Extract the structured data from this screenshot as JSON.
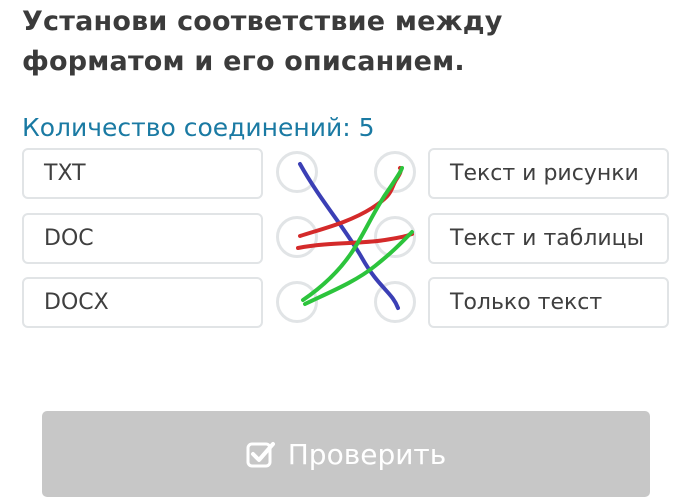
{
  "task": {
    "title": "Установи соответствие между форматом и его описанием.",
    "connections_label": "Количество соединений: 5"
  },
  "left_items": [
    {
      "label": "TXT"
    },
    {
      "label": "DOC"
    },
    {
      "label": "DOCX"
    }
  ],
  "right_items": [
    {
      "label": "Текст и рисунки"
    },
    {
      "label": "Текст и таблицы"
    },
    {
      "label": "Только текст"
    }
  ],
  "drawn_connections": [
    {
      "color": "#3b3fb5"
    },
    {
      "color": "#d42a2a"
    },
    {
      "color": "#d42a2a"
    },
    {
      "color": "#2cc43c"
    },
    {
      "color": "#2cc43c"
    }
  ],
  "check_button": {
    "label": "Проверить",
    "icon": "checkbox-check-icon",
    "background": "#c7c7c7"
  },
  "colors": {
    "title": "#3b3b3b",
    "accent": "#1a7aa3",
    "card_border": "#e1e4e6"
  }
}
